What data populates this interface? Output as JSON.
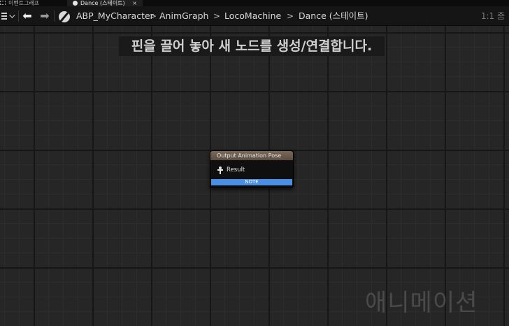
{
  "tabs": [
    {
      "label": "이벤트그래프",
      "icon": "event-graph-icon"
    },
    {
      "label": "Dance (스테이트)",
      "icon": "state-icon",
      "close": "×"
    }
  ],
  "toolbar": {
    "back_icon": "arrow-left-icon",
    "forward_icon": "arrow-right-icon",
    "breadcrumb": [
      "ABP_MyCharacter",
      "AnimGraph",
      "LocoMachine",
      "Dance (스테이트)"
    ],
    "separator": ">",
    "zoom": "1:1 줌"
  },
  "canvas": {
    "hint": "핀을 끌어 놓아 새 노드를 생성/연결합니다.",
    "watermark": "애니메이션"
  },
  "node": {
    "title": "Output Animation Pose",
    "pin_label": "Result",
    "note": "NOTE",
    "header_color": "#6a5c4e",
    "note_color": "#4a8fe6"
  }
}
